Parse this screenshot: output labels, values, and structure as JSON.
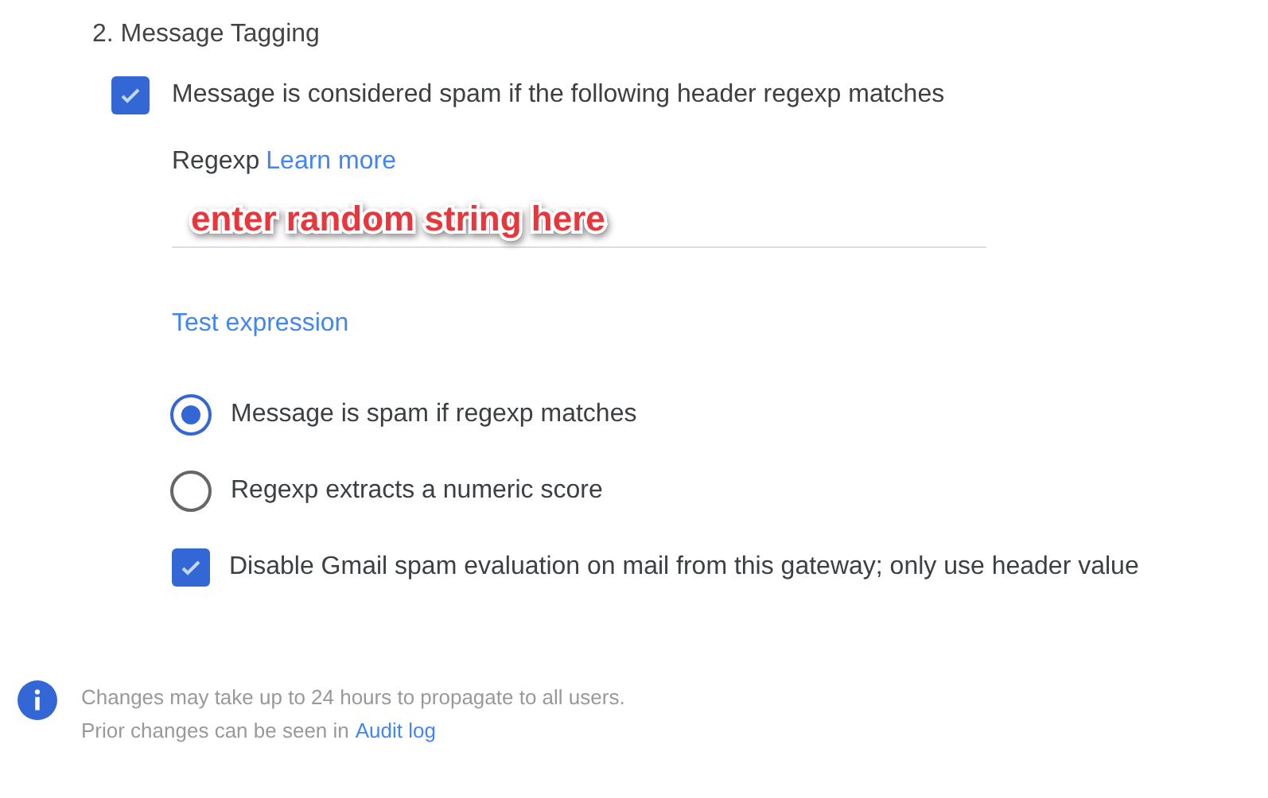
{
  "section_title": "2. Message Tagging",
  "header_option": {
    "label": "Message is considered spam if the following header regexp matches",
    "checked": true
  },
  "regexp": {
    "label": "Regexp",
    "link": "Learn more",
    "annotation": "enter random string here"
  },
  "test_link": "Test expression",
  "options": [
    {
      "kind": "radio",
      "label": "Message is spam if regexp matches",
      "selected": true
    },
    {
      "kind": "radio",
      "label": "Regexp extracts a numeric score",
      "selected": false
    },
    {
      "kind": "checkbox",
      "label": "Disable Gmail spam evaluation on mail from this gateway; only use header value",
      "checked": true
    }
  ],
  "info": {
    "line_1": "Changes may take up to 24 hours to propagate to all users.",
    "line_2": "Prior changes can be seen in",
    "link": "Audit log"
  }
}
